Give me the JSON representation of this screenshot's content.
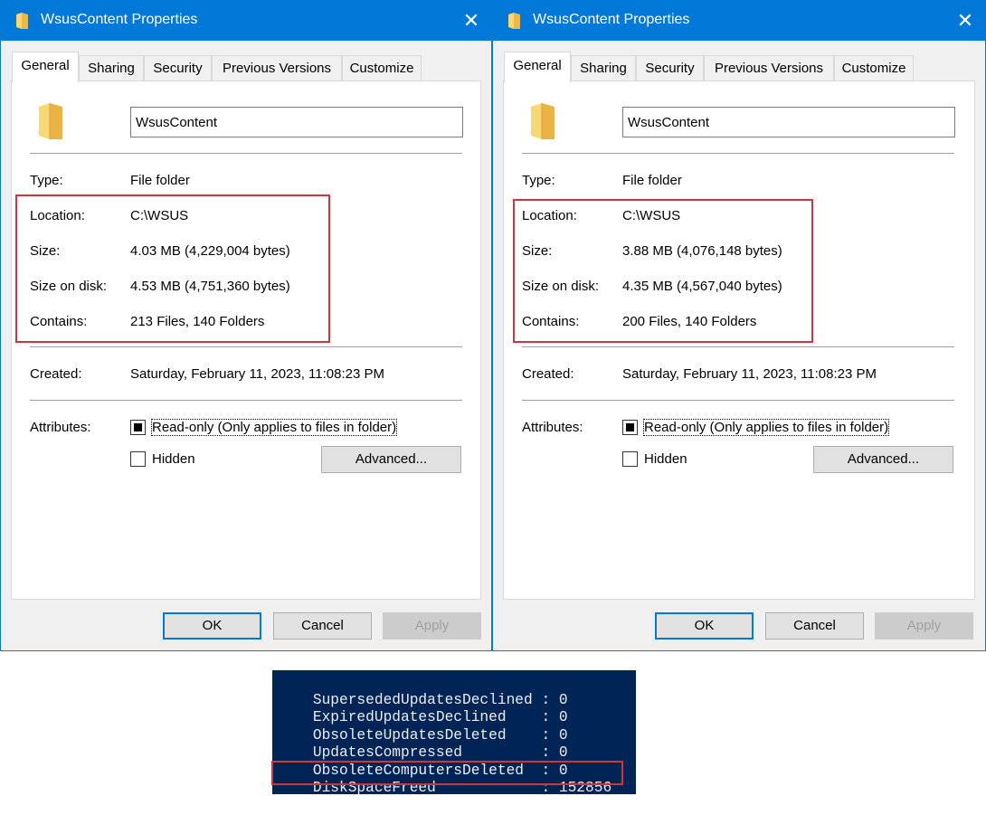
{
  "dialogs": [
    {
      "title": "WsusContent Properties",
      "tabs": [
        "General",
        "Sharing",
        "Security",
        "Previous Versions",
        "Customize"
      ],
      "active_tab": "General",
      "name_value": "WsusContent",
      "type_label": "Type:",
      "type_value": "File folder",
      "location_label": "Location:",
      "location_value": "C:\\WSUS",
      "size_label": "Size:",
      "size_value": "4.03 MB (4,229,004 bytes)",
      "disk_label": "Size on disk:",
      "disk_value": "4.53 MB (4,751,360 bytes)",
      "contains_label": "Contains:",
      "contains_value": "213 Files, 140 Folders",
      "created_label": "Created:",
      "created_value": "Saturday, February 11, 2023, 11:08:23 PM",
      "attributes_label": "Attributes:",
      "readonly_label": "Read-only (Only applies to files in folder)",
      "hidden_label": "Hidden",
      "advanced_label": "Advanced...",
      "ok_label": "OK",
      "cancel_label": "Cancel",
      "apply_label": "Apply",
      "close_glyph": "✕"
    },
    {
      "title": "WsusContent Properties",
      "tabs": [
        "General",
        "Sharing",
        "Security",
        "Previous Versions",
        "Customize"
      ],
      "active_tab": "General",
      "name_value": "WsusContent",
      "type_label": "Type:",
      "type_value": "File folder",
      "location_label": "Location:",
      "location_value": "C:\\WSUS",
      "size_label": "Size:",
      "size_value": "3.88 MB (4,076,148 bytes)",
      "disk_label": "Size on disk:",
      "disk_value": "4.35 MB (4,567,040 bytes)",
      "contains_label": "Contains:",
      "contains_value": "200 Files, 140 Folders",
      "created_label": "Created:",
      "created_value": "Saturday, February 11, 2023, 11:08:23 PM",
      "attributes_label": "Attributes:",
      "readonly_label": "Read-only (Only applies to files in folder)",
      "hidden_label": "Hidden",
      "advanced_label": "Advanced...",
      "ok_label": "OK",
      "cancel_label": "Cancel",
      "apply_label": "Apply",
      "close_glyph": "✕"
    }
  ],
  "terminal": {
    "lines": [
      {
        "key": "SupersededUpdatesDeclined",
        "value": "0"
      },
      {
        "key": "ExpiredUpdatesDeclined",
        "value": "0"
      },
      {
        "key": "ObsoleteUpdatesDeleted",
        "value": "0"
      },
      {
        "key": "UpdatesCompressed",
        "value": "0"
      },
      {
        "key": "ObsoleteComputersDeleted",
        "value": "0"
      },
      {
        "key": "DiskSpaceFreed",
        "value": "152856"
      }
    ],
    "separator": ":"
  },
  "colors": {
    "titlebar": "#0078d7",
    "highlight": "#d1343c",
    "terminal_bg": "#012456",
    "folder": "#f5c542"
  }
}
